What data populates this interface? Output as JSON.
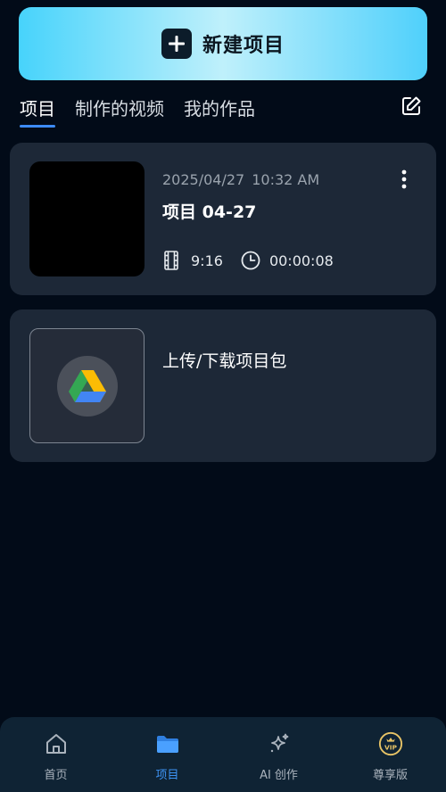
{
  "new_project": {
    "label": "新建项目"
  },
  "tabs": [
    {
      "label": "项目",
      "active": true
    },
    {
      "label": "制作的视频",
      "active": false
    },
    {
      "label": "我的作品",
      "active": false
    }
  ],
  "projects": [
    {
      "date": "2025/04/27",
      "time": "10:32 AM",
      "title": "项目 04-27",
      "ratio": "9:16",
      "duration": "00:00:08"
    }
  ],
  "upload_card": {
    "label": "上传/下载项目包"
  },
  "bottom_nav": [
    {
      "label": "首页",
      "icon": "home-icon",
      "active": false
    },
    {
      "label": "项目",
      "icon": "folder-icon",
      "active": true
    },
    {
      "label": "AI 创作",
      "icon": "sparkle-icon",
      "active": false
    },
    {
      "label": "尊享版",
      "icon": "vip-badge-icon",
      "active": false
    }
  ],
  "colors": {
    "background": "#020b18",
    "card": "#1d2837",
    "accent": "#3d8bf5",
    "button_gradient_start": "#47d3fb",
    "button_gradient_mid": "#bff0fb",
    "vip_gold": "#e8c466"
  }
}
